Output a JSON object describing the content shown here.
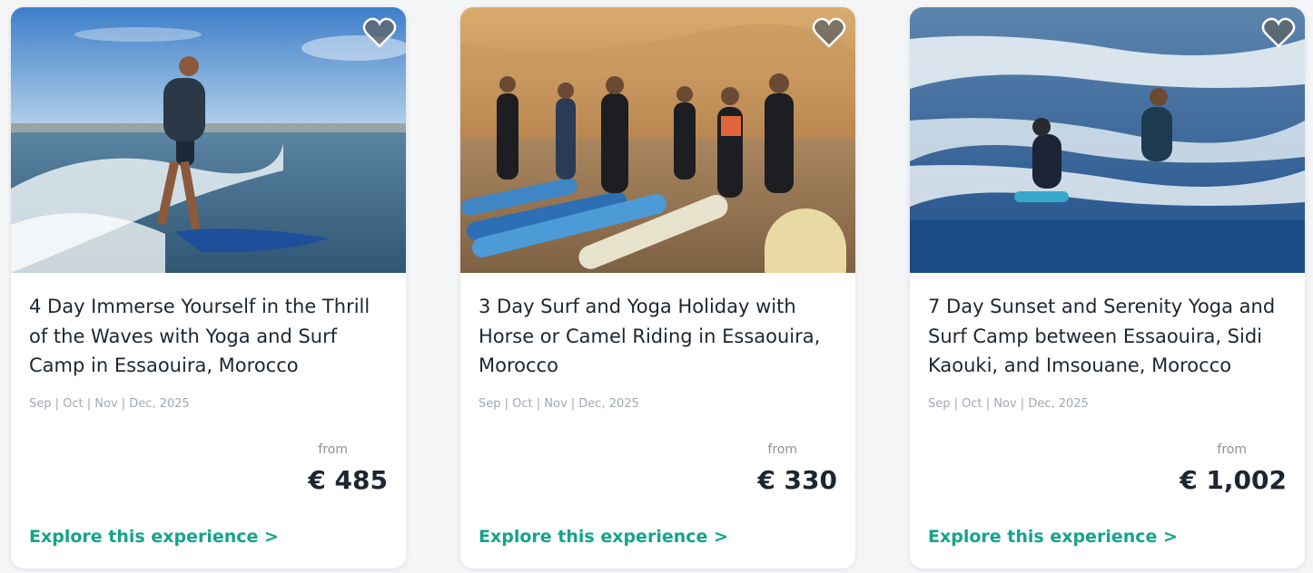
{
  "cards": [
    {
      "title": "4 Day Immerse Yourself in the Thrill of the Waves with Yoga and Surf Camp in Essaouira, Morocco",
      "dates": "Sep | Oct | Nov | Dec, 2025",
      "from_label": "from",
      "price": "€ 485",
      "cta": "Explore this experience >",
      "favorite_icon": "heart-icon"
    },
    {
      "title": "3 Day Surf and Yoga Holiday with Horse or Camel Riding in Essaouira, Morocco",
      "dates": "Sep | Oct | Nov | Dec, 2025",
      "from_label": "from",
      "price": "€ 330",
      "cta": "Explore this experience >",
      "favorite_icon": "heart-icon"
    },
    {
      "title": "7 Day Sunset and Serenity Yoga and Surf Camp between Essaouira, Sidi Kaouki, and Imsouane, Morocco",
      "dates": "Sep | Oct | Nov | Dec, 2025",
      "from_label": "from",
      "price": "€ 1,002",
      "cta": "Explore this experience >",
      "favorite_icon": "heart-icon"
    }
  ],
  "colors": {
    "accent": "#14a38b",
    "title_text": "#1f2530",
    "muted_text": "#a3a8b0",
    "heart_fill": "#5d6166"
  }
}
